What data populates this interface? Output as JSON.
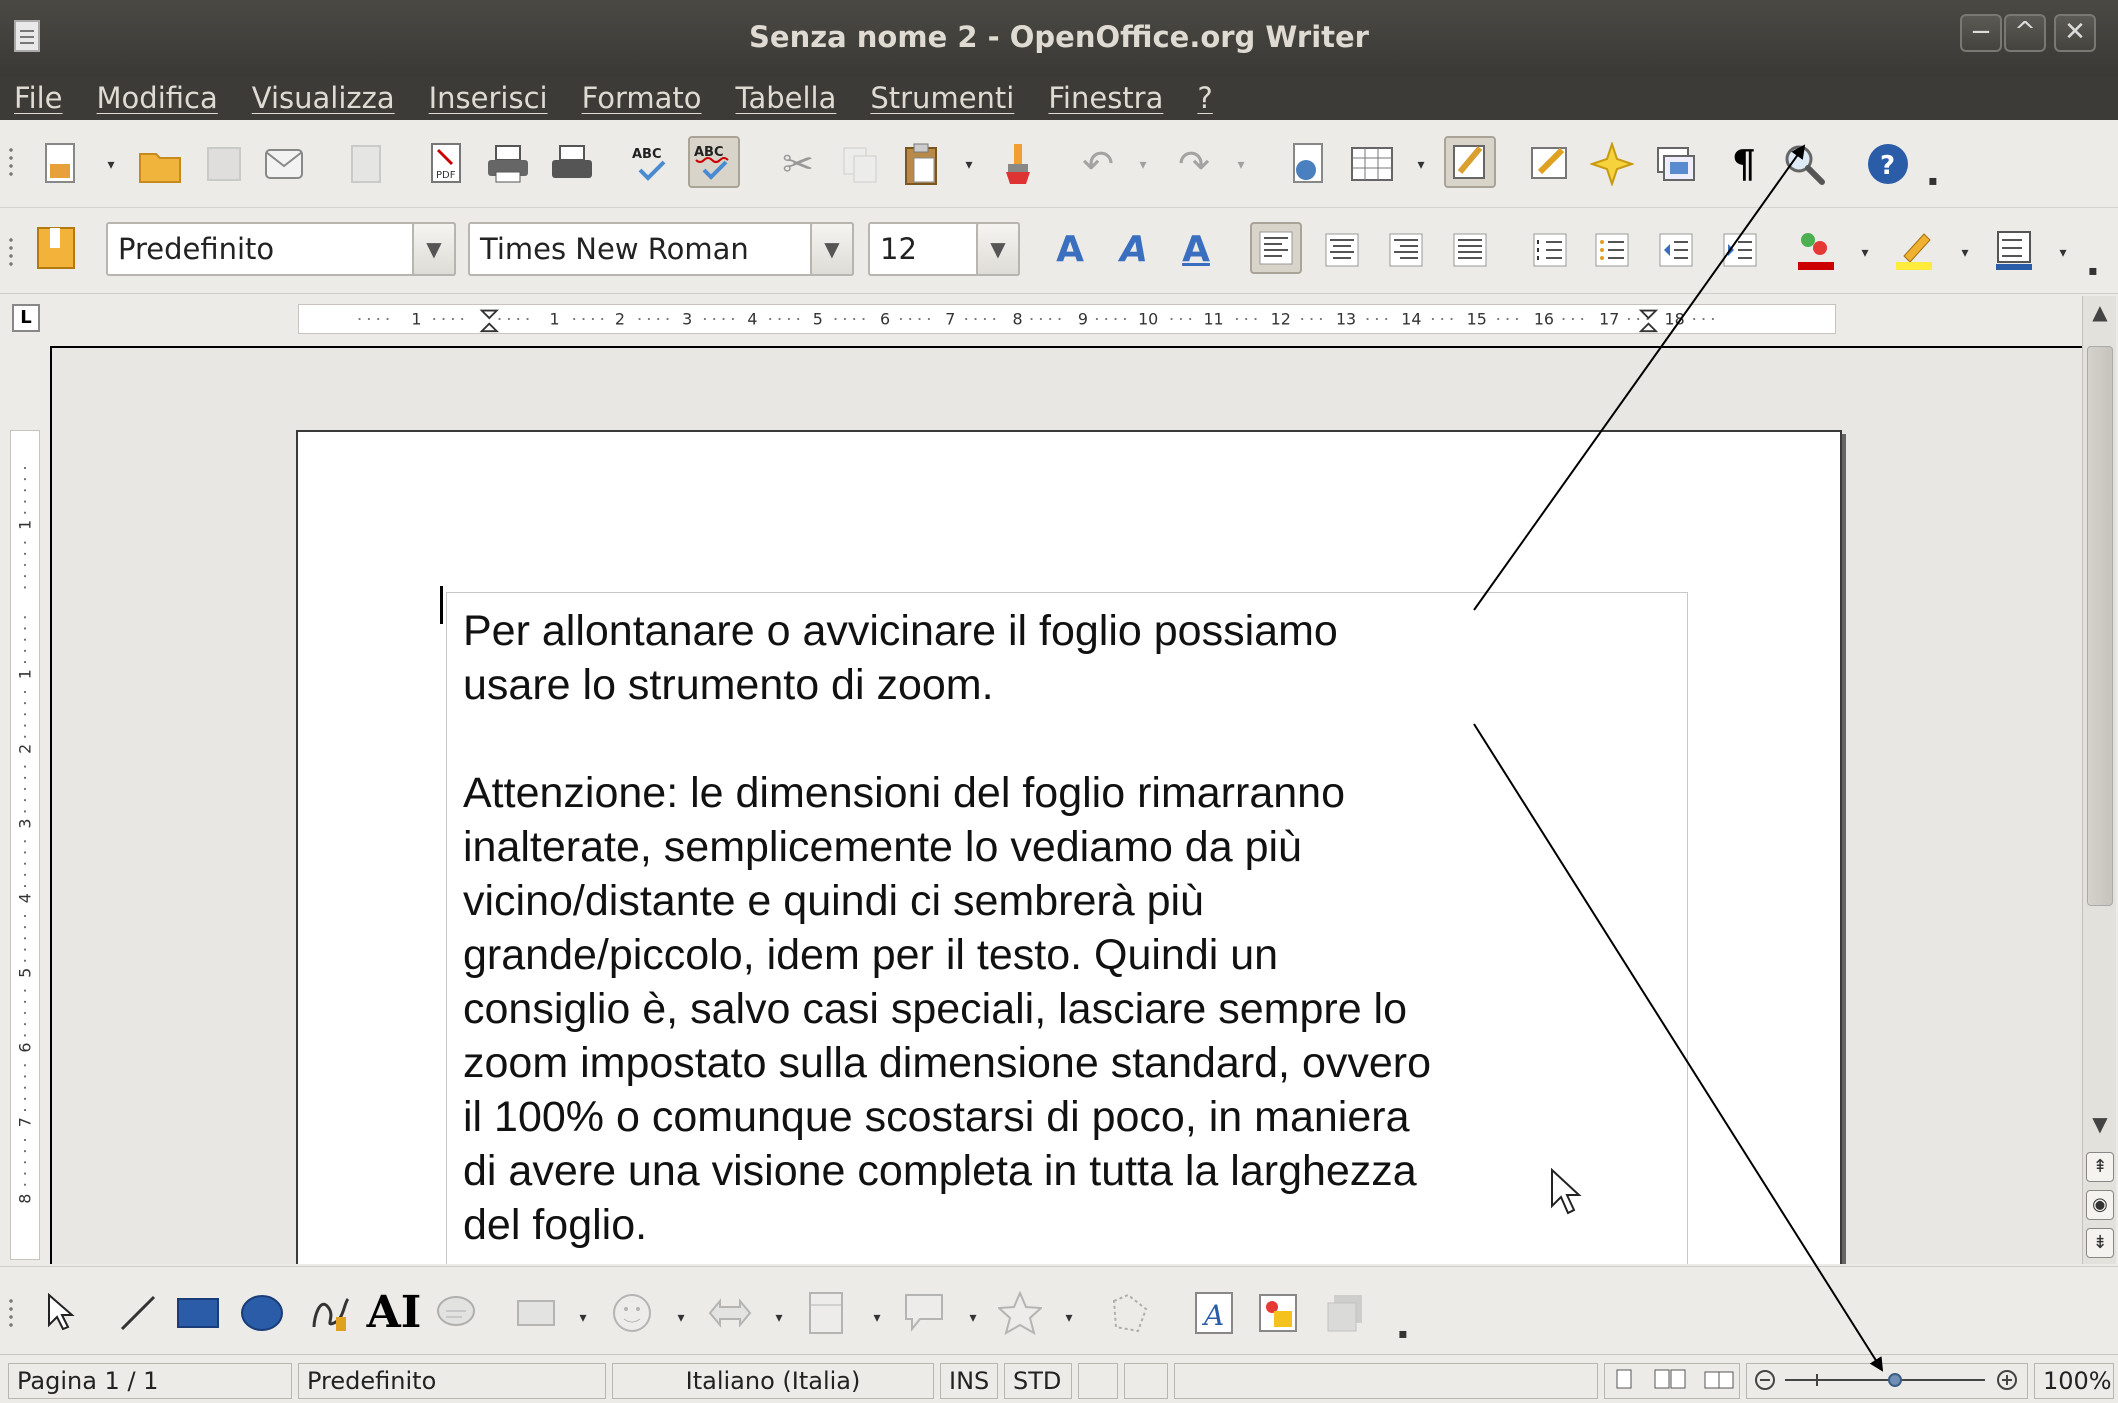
{
  "window": {
    "title": "Senza nome 2 - OpenOffice.org Writer",
    "minimize_glyph": "−",
    "maximize_glyph": "^",
    "close_glyph": "✕"
  },
  "menu": {
    "items": [
      "File",
      "Modifica",
      "Visualizza",
      "Inserisci",
      "Formato",
      "Tabella",
      "Strumenti",
      "Finestra",
      "?"
    ]
  },
  "formatting": {
    "paragraph_style": "Predefinito",
    "font_name": "Times New Roman",
    "font_size": "12"
  },
  "ruler": {
    "corner_glyph": "L"
  },
  "document": {
    "text": "Per allontanare o avvicinare il foglio possiamo\nusare lo strumento di zoom.\n\nAttenzione: le dimensioni del foglio rimarranno\ninalterate, semplicemente lo vediamo da più\nvicino/distante e quindi ci sembrerà più\ngrande/piccolo, idem per il testo. Quindi un\nconsiglio è, salvo casi speciali, lasciare sempre lo\nzoom impostato sulla dimensione standard, ovvero\nil 100% o comunque scostarsi di poco, in maniera\ndi avere una visione completa in tutta la larghezza\ndel foglio."
  },
  "status": {
    "page": "Pagina 1 / 1",
    "style": "Predefinito",
    "language": "Italiano (Italia)",
    "insert_mode": "INS",
    "selection_mode": "STD",
    "zoom": "100%"
  },
  "icons": {
    "zoom_tool": "magnifier-icon",
    "help": "help-icon",
    "zoom_slider": "zoom-slider"
  },
  "colors": {
    "titlebar": "#3c3b37",
    "annotation_arrow": "#000000"
  }
}
